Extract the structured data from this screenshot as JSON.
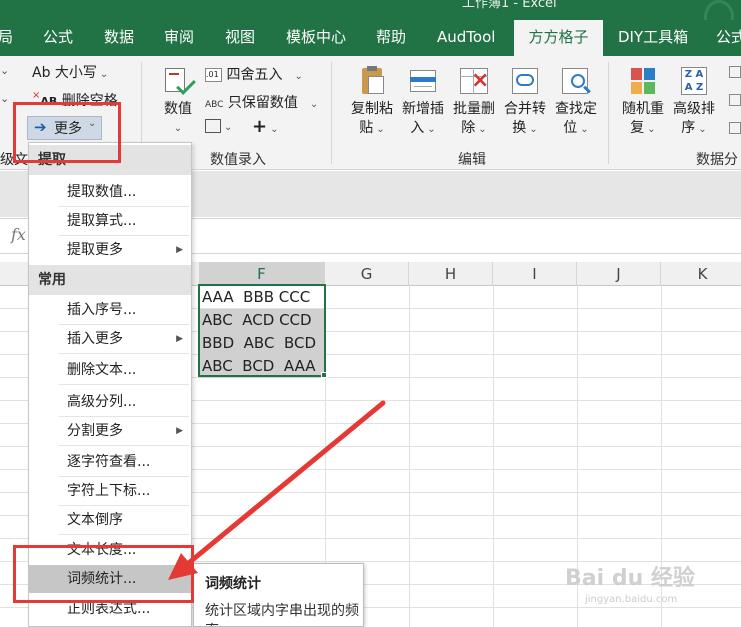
{
  "window": {
    "title": "工作簿1 - Excel"
  },
  "tabs": [
    "局",
    "公式",
    "数据",
    "审阅",
    "视图",
    "模板中心",
    "帮助",
    "AudTool",
    "方方格子",
    "DIY工具箱",
    "公式"
  ],
  "active_tab": "方方格子",
  "ribbon": {
    "text_group": {
      "case_label": "Ab 大小写",
      "remove_spaces_label": "删除空格",
      "more_label": "更多",
      "partial_label": "级文本"
    },
    "numeric_group": {
      "label": "数值录入",
      "value_btn": "数值",
      "round_label": "四舍五入",
      "keep_value_label": "只保留数值"
    },
    "edit_group": {
      "label": "编辑",
      "buttons": [
        {
          "line1": "复制粘",
          "line2": "贴"
        },
        {
          "line1": "新增插",
          "line2": "入"
        },
        {
          "line1": "批量删",
          "line2": "除"
        },
        {
          "line1": "合并转",
          "line2": "换"
        },
        {
          "line1": "查找定",
          "line2": "位"
        }
      ]
    },
    "analysis_group": {
      "label": "数据分",
      "buttons": [
        {
          "line1": "随机重",
          "line2": "复"
        },
        {
          "line1": "高级排",
          "line2": "序"
        }
      ]
    }
  },
  "formula_bar": {
    "fx": "fx"
  },
  "grid": {
    "columns": [
      "F",
      "G",
      "H",
      "I",
      "J",
      "K"
    ],
    "selected_column": "F",
    "cells": [
      "AAA  BBB CCC",
      "ABC  ACD CCD",
      "BBD  ABC  BCD",
      "ABC  BCD  AAA"
    ]
  },
  "menu": {
    "sections": [
      {
        "header": "提取",
        "items": [
          "提取数值...",
          "提取算式...",
          "提取更多"
        ]
      },
      {
        "header": "常用",
        "items": [
          "插入序号...",
          "插入更多",
          "删除文本...",
          "高级分列...",
          "分割更多",
          "逐字符查看...",
          "字符上下标...",
          "文本倒序",
          "文本长度...",
          "词频统计...",
          "正则表达式..."
        ]
      }
    ],
    "highlighted": "词频统计..."
  },
  "tooltip": {
    "title": "词频统计",
    "body": "统计区域内字串出现的频率"
  },
  "watermark": {
    "main": "Bai du 经验",
    "sub": "jingyan.baidu.com"
  }
}
